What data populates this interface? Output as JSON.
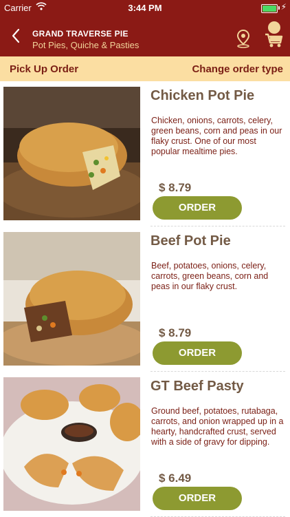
{
  "status_bar": {
    "carrier": "Carrier",
    "time": "3:44 PM"
  },
  "nav": {
    "title": "GRAND TRAVERSE PIE",
    "subtitle": "Pot Pies, Quiche & Pasties",
    "icons": [
      "back-chevron-icon",
      "location-pin-icon",
      "cart-icon"
    ]
  },
  "order_bar": {
    "label": "Pick Up Order",
    "change_label": "Change order type"
  },
  "menu_items": [
    {
      "name": "Chicken Pot Pie",
      "description": "Chicken, onions, carrots, celery, green beans, corn and peas in our flaky crust. One of our most popular mealtime pies.",
      "price": "$ 8.79",
      "button": "ORDER"
    },
    {
      "name": "Beef Pot Pie",
      "description": "Beef, potatoes, onions, celery, carrots, green beans, corn and peas in our flaky crust.",
      "price": "$ 8.79",
      "button": "ORDER"
    },
    {
      "name": "GT Beef Pasty",
      "description": "Ground beef, potatoes, rutabaga, carrots, and onion wrapped up in a hearty, handcrafted crust, served with a side of gravy for dipping.",
      "price": "$ 6.49",
      "button": "ORDER"
    }
  ],
  "colors": {
    "nav_bg": "#8b1a15",
    "order_bar_bg": "#fbdea2",
    "order_text": "#7a1e14",
    "item_title": "#735a45",
    "button_bg": "#8d9a31"
  }
}
